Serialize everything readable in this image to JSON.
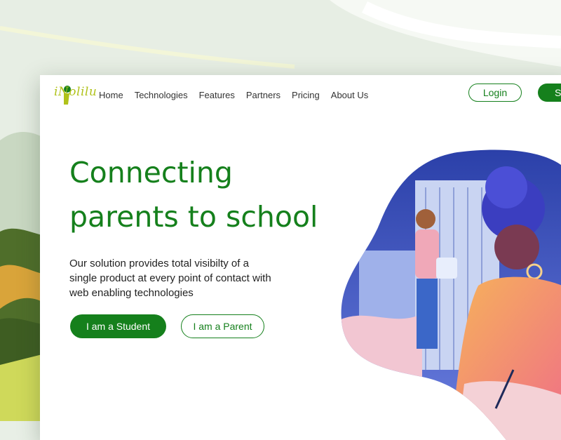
{
  "brand": {
    "logo_text": "iNolilu"
  },
  "nav": {
    "items": [
      "Home",
      "Technologies",
      "Features",
      "Partners",
      "Pricing",
      "About Us"
    ]
  },
  "header": {
    "login_label": "Login",
    "signup_label": "S"
  },
  "hero": {
    "title_line1": "Connecting",
    "title_line2": "parents to school",
    "subtitle": "Our solution provides total visibilty of a single product at every point of contact with web enabling technologies",
    "student_button": "I am a Student",
    "parent_button": "I am a Parent"
  },
  "colors": {
    "primary": "#15801c",
    "logo": "#b0c21a",
    "backdrop": "#e8efe6"
  },
  "icons": [
    "logo-figure-icon"
  ]
}
